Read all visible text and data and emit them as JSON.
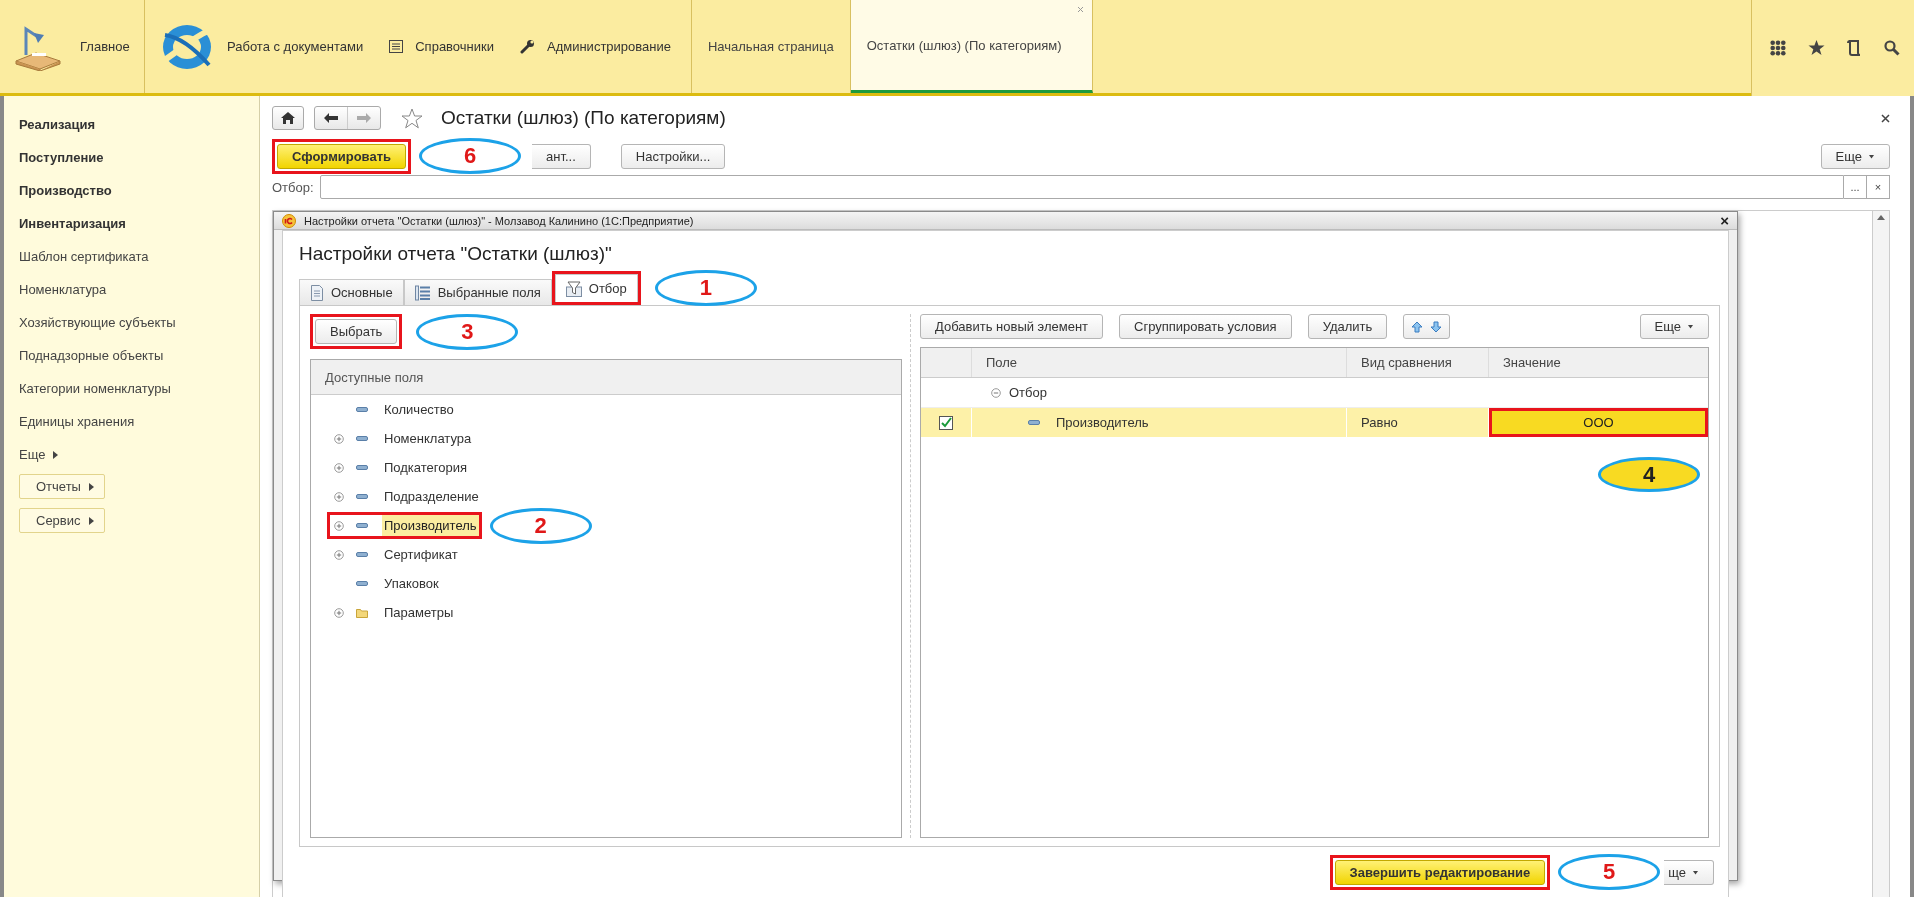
{
  "nav": {
    "home": {
      "label": "Главное"
    },
    "sections": [
      {
        "label": "Работа с документами",
        "kind": "logo"
      },
      {
        "label": "Справочники",
        "kind": "list"
      },
      {
        "label": "Администрирование",
        "kind": "wrench"
      }
    ],
    "tabs": [
      {
        "label": "Начальная страница",
        "selected": false
      },
      {
        "label": "Остатки (шлюз) (По категориям)",
        "selected": true
      }
    ]
  },
  "sidebar": {
    "items": [
      {
        "label": "Реализация",
        "kind": "section"
      },
      {
        "label": "Поступление",
        "kind": "section"
      },
      {
        "label": "Производство",
        "kind": "section"
      },
      {
        "label": "Инвентаризация",
        "kind": "section"
      },
      {
        "label": "Шаблон сертификата",
        "kind": "item"
      },
      {
        "label": "Номенклатура",
        "kind": "item"
      },
      {
        "label": "Хозяйствующие субъекты",
        "kind": "item"
      },
      {
        "label": "Поднадзорные объекты",
        "kind": "item"
      },
      {
        "label": "Категории номенклатуры",
        "kind": "item"
      },
      {
        "label": "Единицы хранения",
        "kind": "item"
      },
      {
        "label": "Еще",
        "kind": "more"
      },
      {
        "label": "Отчеты",
        "kind": "button"
      },
      {
        "label": "Сервис",
        "kind": "button"
      }
    ]
  },
  "form": {
    "title": "Остатки (шлюз) (По категориям)",
    "buttons": [
      {
        "label": "Сформировать",
        "kind": "primary",
        "highlighted": true,
        "callout": "6"
      },
      {
        "label": "ант...",
        "kind": "normal",
        "highlighted": false
      },
      {
        "label": "Настройки...",
        "kind": "normal",
        "highlighted": false
      }
    ],
    "more": "Еще",
    "filter": {
      "label": "Отбор:",
      "select": "...",
      "clear": "×"
    }
  },
  "dialog": {
    "window_title": "Настройки отчета \"Остатки (шлюз)\" - Молзавод Калинино (1С:Предприятие)",
    "close": "×",
    "heading": "Настройки отчета \"Остатки (шлюз)\"",
    "tabs": [
      {
        "label": "Основные",
        "kind": "doc",
        "selected": false,
        "highlighted": false
      },
      {
        "label": "Выбранные поля",
        "kind": "fields",
        "selected": false,
        "highlighted": false
      },
      {
        "label": "Отбор",
        "kind": "filter",
        "selected": true,
        "highlighted": true,
        "callout": "1"
      }
    ],
    "choose": {
      "label": "Выбрать",
      "highlighted": true,
      "callout": "3"
    },
    "fields": {
      "header": "Доступные поля",
      "items": [
        {
          "label": "Количество",
          "expandable": false,
          "kind": "field",
          "selected": false,
          "highlighted": false
        },
        {
          "label": "Номенклатура",
          "expandable": true,
          "kind": "field",
          "selected": false,
          "highlighted": false
        },
        {
          "label": "Подкатегория",
          "expandable": true,
          "kind": "field",
          "selected": false,
          "highlighted": false
        },
        {
          "label": "Подразделение",
          "expandable": true,
          "kind": "field",
          "selected": false,
          "highlighted": false
        },
        {
          "label": "Производитель",
          "expandable": true,
          "kind": "field",
          "selected": true,
          "highlighted": true,
          "callout": "2"
        },
        {
          "label": "Сертификат",
          "expandable": true,
          "kind": "field",
          "selected": false,
          "highlighted": false
        },
        {
          "label": "Упаковок",
          "expandable": false,
          "kind": "field",
          "selected": false,
          "highlighted": false
        },
        {
          "label": "Параметры",
          "expandable": true,
          "kind": "folder",
          "selected": false,
          "highlighted": false
        }
      ]
    },
    "toolbar": [
      "Добавить новый элемент",
      "Сгруппировать условия",
      "Удалить"
    ],
    "more": "Еще",
    "table": {
      "columns": [
        "Поле",
        "Вид сравнения",
        "Значение"
      ],
      "group": {
        "label": "Отбор",
        "expanded": true
      },
      "rows": [
        {
          "checked": true,
          "selected": true,
          "field": "Производитель",
          "comparison": "Равно",
          "value": "ООО",
          "highlighted": true,
          "callout": "4"
        }
      ]
    },
    "finish": {
      "label": "Завершить редактирование",
      "highlighted": true,
      "callout": "5"
    },
    "more_bottom": "ще"
  }
}
